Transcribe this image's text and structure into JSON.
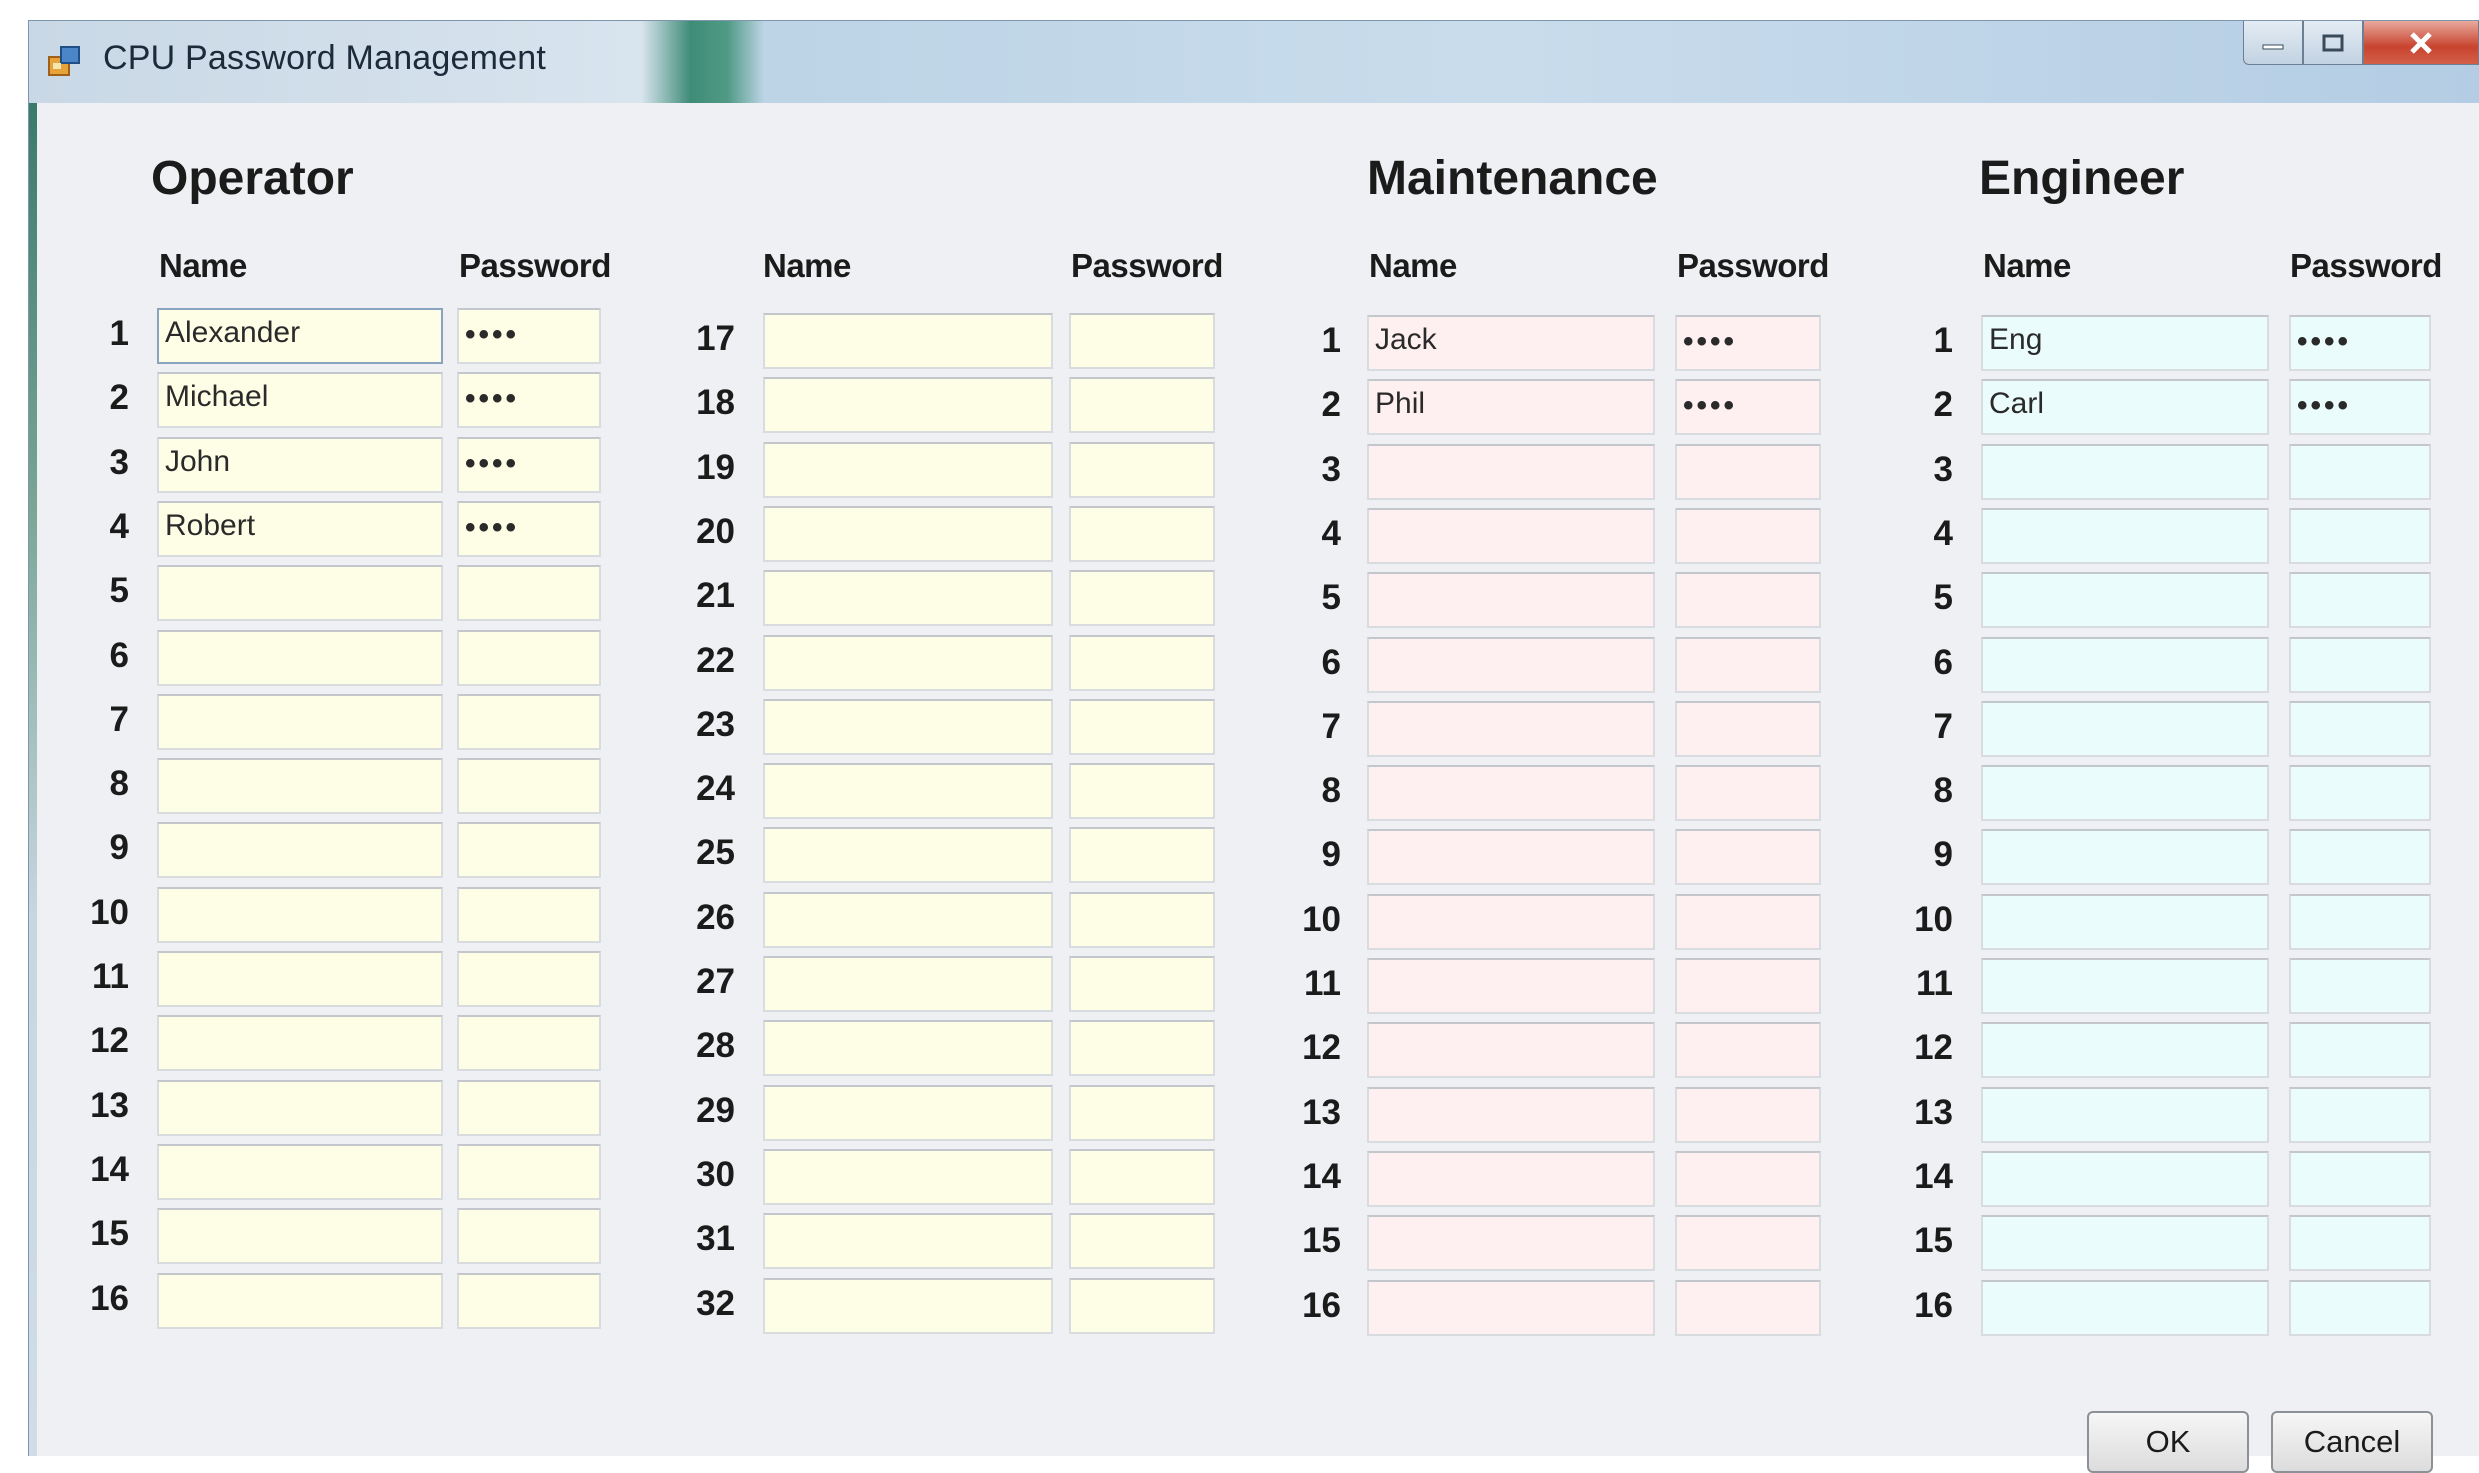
{
  "window": {
    "title": "CPU Password Management"
  },
  "operator": {
    "title": "Operator",
    "name_header": "Name",
    "password_header": "Password",
    "rows": [
      {
        "num": "1",
        "name": "Alexander",
        "password": "••••"
      },
      {
        "num": "2",
        "name": "Michael",
        "password": "••••"
      },
      {
        "num": "3",
        "name": "John",
        "password": "••••"
      },
      {
        "num": "4",
        "name": "Robert",
        "password": "••••"
      },
      {
        "num": "5",
        "name": "",
        "password": ""
      },
      {
        "num": "6",
        "name": "",
        "password": ""
      },
      {
        "num": "7",
        "name": "",
        "password": ""
      },
      {
        "num": "8",
        "name": "",
        "password": ""
      },
      {
        "num": "9",
        "name": "",
        "password": ""
      },
      {
        "num": "10",
        "name": "",
        "password": ""
      },
      {
        "num": "11",
        "name": "",
        "password": ""
      },
      {
        "num": "12",
        "name": "",
        "password": ""
      },
      {
        "num": "13",
        "name": "",
        "password": ""
      },
      {
        "num": "14",
        "name": "",
        "password": ""
      },
      {
        "num": "15",
        "name": "",
        "password": ""
      },
      {
        "num": "16",
        "name": "",
        "password": ""
      }
    ],
    "rows2": [
      {
        "num": "17",
        "name": "",
        "password": ""
      },
      {
        "num": "18",
        "name": "",
        "password": ""
      },
      {
        "num": "19",
        "name": "",
        "password": ""
      },
      {
        "num": "20",
        "name": "",
        "password": ""
      },
      {
        "num": "21",
        "name": "",
        "password": ""
      },
      {
        "num": "22",
        "name": "",
        "password": ""
      },
      {
        "num": "23",
        "name": "",
        "password": ""
      },
      {
        "num": "24",
        "name": "",
        "password": ""
      },
      {
        "num": "25",
        "name": "",
        "password": ""
      },
      {
        "num": "26",
        "name": "",
        "password": ""
      },
      {
        "num": "27",
        "name": "",
        "password": ""
      },
      {
        "num": "28",
        "name": "",
        "password": ""
      },
      {
        "num": "29",
        "name": "",
        "password": ""
      },
      {
        "num": "30",
        "name": "",
        "password": ""
      },
      {
        "num": "31",
        "name": "",
        "password": ""
      },
      {
        "num": "32",
        "name": "",
        "password": ""
      }
    ]
  },
  "maintenance": {
    "title": "Maintenance",
    "name_header": "Name",
    "password_header": "Password",
    "rows": [
      {
        "num": "1",
        "name": "Jack",
        "password": "••••"
      },
      {
        "num": "2",
        "name": "Phil",
        "password": "••••"
      },
      {
        "num": "3",
        "name": "",
        "password": ""
      },
      {
        "num": "4",
        "name": "",
        "password": ""
      },
      {
        "num": "5",
        "name": "",
        "password": ""
      },
      {
        "num": "6",
        "name": "",
        "password": ""
      },
      {
        "num": "7",
        "name": "",
        "password": ""
      },
      {
        "num": "8",
        "name": "",
        "password": ""
      },
      {
        "num": "9",
        "name": "",
        "password": ""
      },
      {
        "num": "10",
        "name": "",
        "password": ""
      },
      {
        "num": "11",
        "name": "",
        "password": ""
      },
      {
        "num": "12",
        "name": "",
        "password": ""
      },
      {
        "num": "13",
        "name": "",
        "password": ""
      },
      {
        "num": "14",
        "name": "",
        "password": ""
      },
      {
        "num": "15",
        "name": "",
        "password": ""
      },
      {
        "num": "16",
        "name": "",
        "password": ""
      }
    ]
  },
  "engineer": {
    "title": "Engineer",
    "name_header": "Name",
    "password_header": "Password",
    "rows": [
      {
        "num": "1",
        "name": "Eng",
        "password": "••••"
      },
      {
        "num": "2",
        "name": "Carl",
        "password": "••••"
      },
      {
        "num": "3",
        "name": "",
        "password": ""
      },
      {
        "num": "4",
        "name": "",
        "password": ""
      },
      {
        "num": "5",
        "name": "",
        "password": ""
      },
      {
        "num": "6",
        "name": "",
        "password": ""
      },
      {
        "num": "7",
        "name": "",
        "password": ""
      },
      {
        "num": "8",
        "name": "",
        "password": ""
      },
      {
        "num": "9",
        "name": "",
        "password": ""
      },
      {
        "num": "10",
        "name": "",
        "password": ""
      },
      {
        "num": "11",
        "name": "",
        "password": ""
      },
      {
        "num": "12",
        "name": "",
        "password": ""
      },
      {
        "num": "13",
        "name": "",
        "password": ""
      },
      {
        "num": "14",
        "name": "",
        "password": ""
      },
      {
        "num": "15",
        "name": "",
        "password": ""
      },
      {
        "num": "16",
        "name": "",
        "password": ""
      }
    ]
  },
  "buttons": {
    "ok": "OK",
    "cancel": "Cancel"
  },
  "colors": {
    "operator_field": "#fefee6",
    "maintenance_field": "#feeff1",
    "engineer_field": "#ebfcfd"
  }
}
